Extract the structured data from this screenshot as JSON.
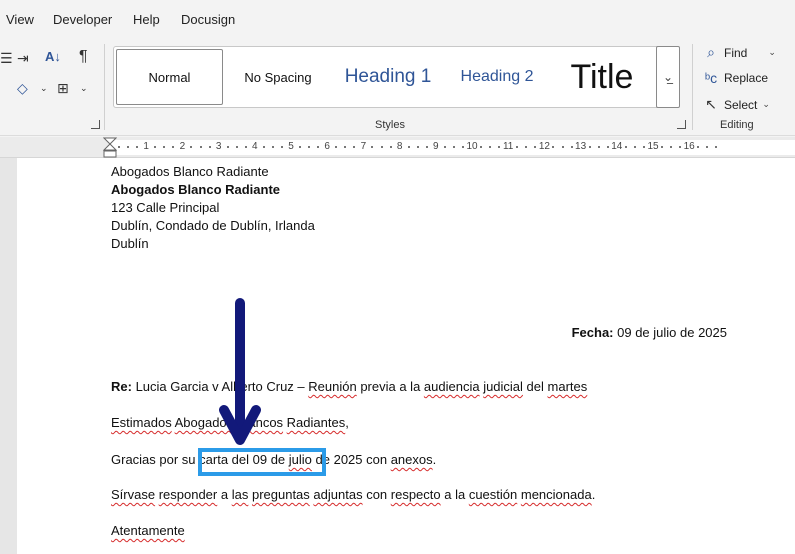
{
  "menu": [
    "View",
    "Developer",
    "Help",
    "Docusign"
  ],
  "styles_group": {
    "label": "Styles",
    "tiles": [
      "Normal",
      "No Spacing",
      "Heading 1",
      "Heading 2",
      "Title"
    ]
  },
  "editing_group": {
    "label": "Editing",
    "find": "Find",
    "replace": "Replace",
    "select": "Select"
  },
  "ruler": {
    "numbers": [
      "1",
      "2",
      "3",
      "4",
      "5",
      "6",
      "7",
      "8",
      "9",
      "10",
      "11",
      "12",
      "13",
      "14",
      "15",
      "16"
    ]
  },
  "document": {
    "sender_line1": "Abogados Blanco Radiante",
    "sender_name_bold": "Abogados Blanco Radiante",
    "address1": "123 Calle Principal",
    "address2": "Dublín, Condado de Dublín, Irlanda",
    "address3": "Dublín",
    "date_label": "Fecha:",
    "date_value": " 09 de julio de 2025",
    "re_label": "Re:",
    "re_text": {
      "a": " Lucia Garcia v Alberto Cruz – ",
      "b": "Reunión",
      "c": " previa a la ",
      "d": "audiencia",
      "e": " ",
      "f": "judicial",
      "g": " del ",
      "h": "martes"
    },
    "salutation": {
      "a": "Estimados",
      "b": " ",
      "c": "Abogados",
      "d": " ",
      "e": "Blancos",
      "f": " ",
      "g": "Radiantes",
      "h": ","
    },
    "body1": {
      "a": "Gracias por su ",
      "b": "carta del 09 de ",
      "c": "julio",
      "d": " de 2025 con ",
      "e": "anexos",
      "f": "."
    },
    "body2": {
      "a": "Sírvase",
      "b": " ",
      "c": "responder",
      "d": " a ",
      "e": "las",
      "f": " ",
      "g": "preguntas",
      "h": " ",
      "i": "adjuntas",
      "j": " con ",
      "k": "respecto",
      "l": " a la ",
      "m": "cuestión",
      "n": " ",
      "o": "mencionada",
      "p": "."
    },
    "closing": "Atentamente"
  },
  "colors": {
    "highlight_box": "#2b9be8",
    "arrow": "#12197a",
    "heading": "#2f5597"
  }
}
